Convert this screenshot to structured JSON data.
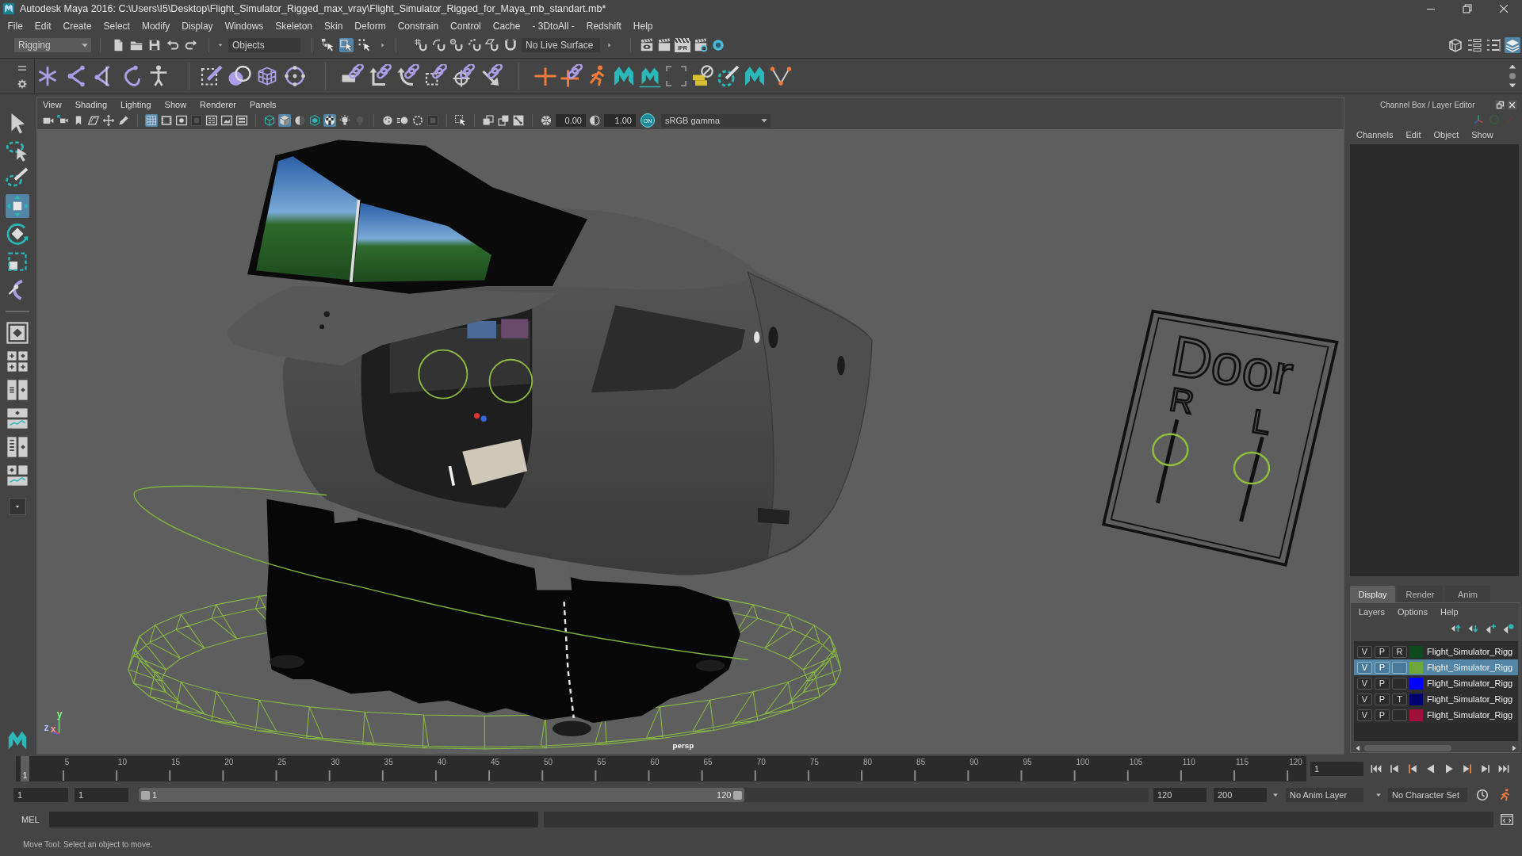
{
  "window": {
    "title": "Autodesk Maya 2016: C:\\Users\\I5\\Desktop\\Flight_Simulator_Rigged_max_vray\\Flight_Simulator_Rigged_for_Maya_mb_standart.mb*"
  },
  "menu_bar": [
    "File",
    "Edit",
    "Create",
    "Select",
    "Modify",
    "Display",
    "Windows",
    "Skeleton",
    "Skin",
    "Deform",
    "Constrain",
    "Control",
    "Cache",
    "- 3DtoAll -",
    "Redshift",
    "Help"
  ],
  "status_line": {
    "menu_set": "Rigging",
    "selection_mode": "Objects",
    "selection_mask": [
      {
        "on": false
      },
      {
        "on": true
      },
      {
        "on": false
      }
    ],
    "live_surface": "No Live Surface",
    "ipr_label": "IPR",
    "panel_toggles": [
      {
        "on": false
      },
      {
        "on": false
      },
      {
        "on": false
      },
      {
        "on": true
      }
    ]
  },
  "toolbox": {
    "tools": [
      {
        "selected": false
      },
      {
        "selected": false
      },
      {
        "selected": false
      },
      {
        "selected": true
      },
      {
        "selected": false
      },
      {
        "selected": false
      },
      {
        "selected": false
      }
    ]
  },
  "viewport": {
    "menu": [
      "View",
      "Shading",
      "Lighting",
      "Show",
      "Renderer",
      "Panels"
    ],
    "toolbar": [
      {
        "on": false
      },
      {
        "on": false
      },
      {
        "on": false
      },
      {
        "on": false
      },
      {
        "on": false
      },
      {
        "on": false
      },
      {
        "on": true
      },
      {
        "on": false
      },
      {
        "on": false
      },
      {
        "on": false
      },
      {
        "on": false
      },
      {
        "on": false
      },
      {
        "on": false
      },
      {
        "on": false
      },
      {
        "on": true
      },
      {
        "on": false
      },
      {
        "on": false
      },
      {
        "on": true
      },
      {
        "on": false
      },
      {
        "on": false
      },
      {
        "on": false
      },
      {
        "on": false
      },
      {
        "on": false
      },
      {
        "on": false
      },
      {
        "on": false
      },
      {
        "on": false
      },
      {
        "on": false
      },
      {
        "on": false
      },
      {
        "on": false
      },
      {
        "on": false
      }
    ],
    "exposure": "0.00",
    "gamma": "1.00",
    "color_management": "ON",
    "color_space": "sRGB gamma",
    "camera_label": "persp",
    "axis_labels": [
      "y",
      "z",
      "x"
    ],
    "door_control": {
      "title": "Door",
      "sliders": [
        {
          "label": "R"
        },
        {
          "label": "L"
        }
      ]
    }
  },
  "channel_box": {
    "title": "Channel Box / Layer Editor",
    "menu": [
      "Channels",
      "Edit",
      "Object",
      "Show"
    ]
  },
  "layer_editor": {
    "tabs": [
      {
        "label": "Display",
        "selected": true
      },
      {
        "label": "Render",
        "selected": false
      },
      {
        "label": "Anim",
        "selected": false
      }
    ],
    "menu": [
      "Layers",
      "Options",
      "Help"
    ],
    "layers": [
      {
        "visibility": "V",
        "playback": "P",
        "display_type": "R",
        "color": "#0d4a1e",
        "name": "Flight_Simulator_Rigg",
        "selected": false
      },
      {
        "visibility": "V",
        "playback": "P",
        "color": "#6ea83a",
        "name": "Flight_Simulator_Rigg",
        "selected": true
      },
      {
        "visibility": "V",
        "playback": "P",
        "color": "#0000ff",
        "name": "Flight_Simulator_Rigg",
        "selected": false
      },
      {
        "visibility": "V",
        "playback": "P",
        "display_type": "T",
        "color": "#000070",
        "name": "Flight_Simulator_Rigg",
        "selected": false
      },
      {
        "visibility": "V",
        "playback": "P",
        "color": "#a0103a",
        "name": "Flight_Simulator_Rigg",
        "selected": false
      }
    ]
  },
  "time_slider": {
    "tick_labels": [
      "5",
      "10",
      "15",
      "20",
      "25",
      "30",
      "35",
      "40",
      "45",
      "50",
      "55",
      "60",
      "65",
      "70",
      "75",
      "80",
      "85",
      "90",
      "95",
      "100",
      "105",
      "110",
      "115",
      "120"
    ],
    "current_frame_marker": "1",
    "level": 0,
    "current_frame": "1"
  },
  "range_slider": {
    "start_time": "1",
    "playback_start": "1",
    "range_start": "1",
    "range_end": "120",
    "level": 0.6,
    "playback_end": "120",
    "end_time": "200",
    "anim_layer": "No Anim Layer",
    "character_set": "No Character Set"
  },
  "command_line": {
    "language": "MEL"
  },
  "help_line": "Move Tool: Select an object to move."
}
